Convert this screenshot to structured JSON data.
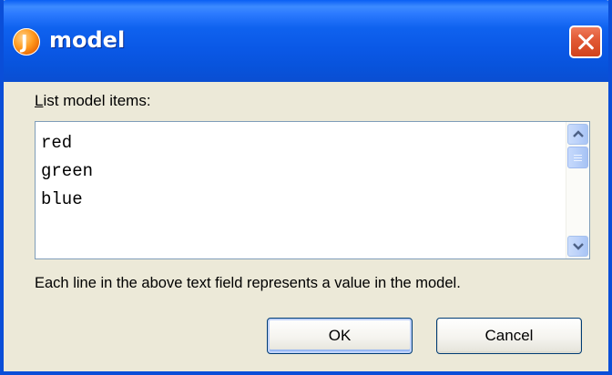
{
  "window": {
    "title": "model",
    "icon": "java-app-icon",
    "close_icon": "close-icon"
  },
  "form": {
    "list_label_mnemonic": "L",
    "list_label_rest": "ist model items:",
    "items": [
      "red",
      "green",
      "blue"
    ],
    "help_text": "Each line in the above text field represents a value in the model."
  },
  "buttons": {
    "ok_label": "OK",
    "cancel_label": "Cancel"
  },
  "colors": {
    "titlebar": "#0a58e6",
    "close_button": "#e25a36",
    "dialog_background": "#ece9d8"
  }
}
